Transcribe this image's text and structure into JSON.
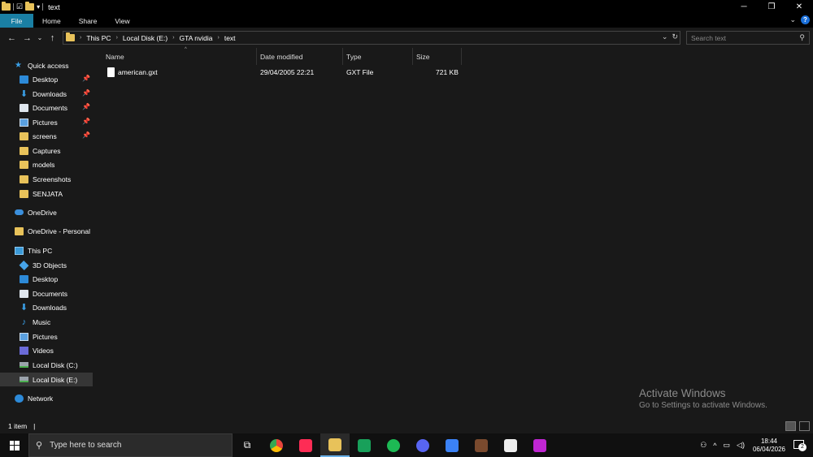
{
  "window": {
    "title": "text",
    "minimize": "─",
    "maximize": "❐",
    "close": "✕"
  },
  "ribbon": {
    "tabs": [
      "File",
      "Home",
      "Share",
      "View"
    ]
  },
  "address": {
    "crumbs": [
      "This PC",
      "Local Disk (E:)",
      "GTA nvidia",
      "text"
    ],
    "search_placeholder": "Search text"
  },
  "sidebar": {
    "quick_access": "Quick access",
    "quick_items": [
      {
        "label": "Desktop",
        "pinned": true
      },
      {
        "label": "Downloads",
        "pinned": true
      },
      {
        "label": "Documents",
        "pinned": true
      },
      {
        "label": "Pictures",
        "pinned": true
      },
      {
        "label": "screens",
        "pinned": true
      },
      {
        "label": "Captures",
        "pinned": false
      },
      {
        "label": "models",
        "pinned": false
      },
      {
        "label": "Screenshots",
        "pinned": false
      },
      {
        "label": "SENJATA",
        "pinned": false
      }
    ],
    "onedrive": "OneDrive",
    "onedrive_personal": "OneDrive - Personal",
    "this_pc": "This PC",
    "pc_items": [
      "3D Objects",
      "Desktop",
      "Documents",
      "Downloads",
      "Music",
      "Pictures",
      "Videos",
      "Local Disk (C:)",
      "Local Disk (E:)"
    ],
    "network": "Network"
  },
  "columns": {
    "name": "Name",
    "date": "Date modified",
    "type": "Type",
    "size": "Size"
  },
  "files": [
    {
      "name": "american.gxt",
      "date": "29/04/2005 22:21",
      "type": "GXT File",
      "size": "721 KB"
    }
  ],
  "watermark": {
    "line1": "Activate Windows",
    "line2": "Go to Settings to activate Windows."
  },
  "status": {
    "count": "1 item",
    "cursor": "|"
  },
  "taskbar": {
    "search_placeholder": "Type here to search",
    "time": "18:44",
    "date": "06/04/2026",
    "notifications": "2",
    "apps": [
      {
        "name": "task-view",
        "color": "#101010"
      },
      {
        "name": "chrome",
        "color": "#e8453c"
      },
      {
        "name": "tiktok",
        "color": "#fe2c55"
      },
      {
        "name": "file-explorer",
        "color": "#e8c25a"
      },
      {
        "name": "app-green",
        "color": "#1db954"
      },
      {
        "name": "spotify",
        "color": "#1db954"
      },
      {
        "name": "discord",
        "color": "#5865f2"
      },
      {
        "name": "roblox",
        "color": "#3b82f6"
      },
      {
        "name": "game",
        "color": "#8a5a3a"
      },
      {
        "name": "capcut",
        "color": "#ffffff"
      },
      {
        "name": "app-purple",
        "color": "#c026d3"
      }
    ]
  }
}
